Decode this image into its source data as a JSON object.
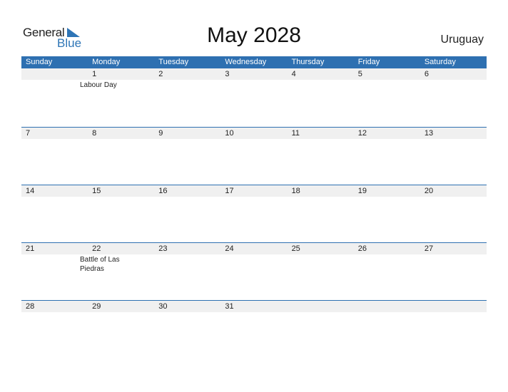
{
  "logo": {
    "general": "General",
    "blue": "Blue"
  },
  "title": "May 2028",
  "country": "Uruguay",
  "weekdays": [
    "Sunday",
    "Monday",
    "Tuesday",
    "Wednesday",
    "Thursday",
    "Friday",
    "Saturday"
  ],
  "weeks": [
    {
      "days": [
        "",
        "1",
        "2",
        "3",
        "4",
        "5",
        "6"
      ],
      "events": [
        "",
        "Labour Day",
        "",
        "",
        "",
        "",
        ""
      ]
    },
    {
      "days": [
        "7",
        "8",
        "9",
        "10",
        "11",
        "12",
        "13"
      ],
      "events": [
        "",
        "",
        "",
        "",
        "",
        "",
        ""
      ]
    },
    {
      "days": [
        "14",
        "15",
        "16",
        "17",
        "18",
        "19",
        "20"
      ],
      "events": [
        "",
        "",
        "",
        "",
        "",
        "",
        ""
      ]
    },
    {
      "days": [
        "21",
        "22",
        "23",
        "24",
        "25",
        "26",
        "27"
      ],
      "events": [
        "",
        "Battle of Las Piedras",
        "",
        "",
        "",
        "",
        ""
      ]
    },
    {
      "days": [
        "28",
        "29",
        "30",
        "31",
        "",
        "",
        ""
      ],
      "events": [
        "",
        "",
        "",
        "",
        "",
        "",
        ""
      ]
    }
  ]
}
